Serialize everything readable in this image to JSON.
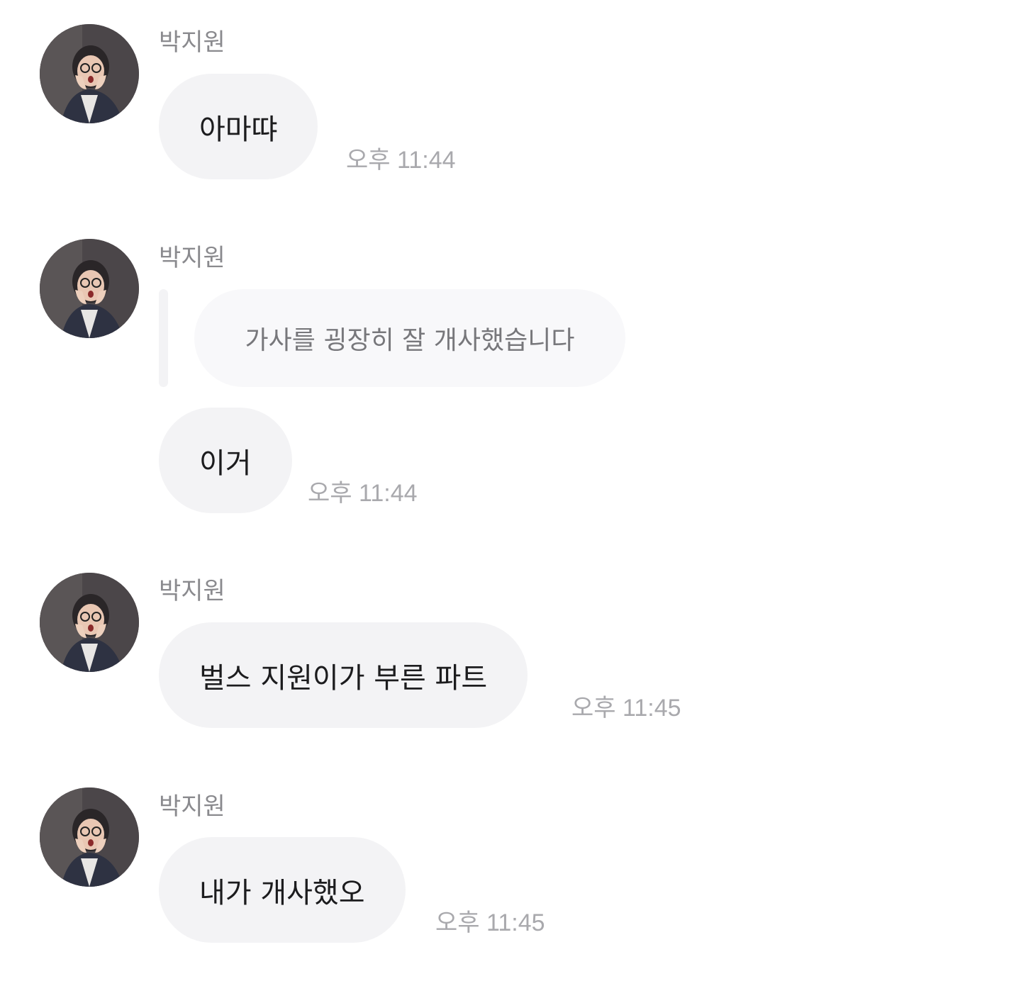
{
  "messages": [
    {
      "sender": "박지원",
      "text": "아마땨",
      "time": "오후 11:44"
    },
    {
      "sender": "박지원",
      "reply_quote": "가사를 굉장히 잘 개사했습니다",
      "text": "이거",
      "time": "오후 11:44"
    },
    {
      "sender": "박지원",
      "text": "벌스 지원이가 부른 파트",
      "time": "오후 11:45"
    },
    {
      "sender": "박지원",
      "text": "내가 개사했오",
      "time": "오후 11:45"
    }
  ],
  "colors": {
    "bubble": "#f3f3f5",
    "reply_bubble": "#f8f8fa",
    "sender_text": "#8a8a8e",
    "time_text": "#a9a9ad",
    "message_text": "#1c1c1e"
  }
}
